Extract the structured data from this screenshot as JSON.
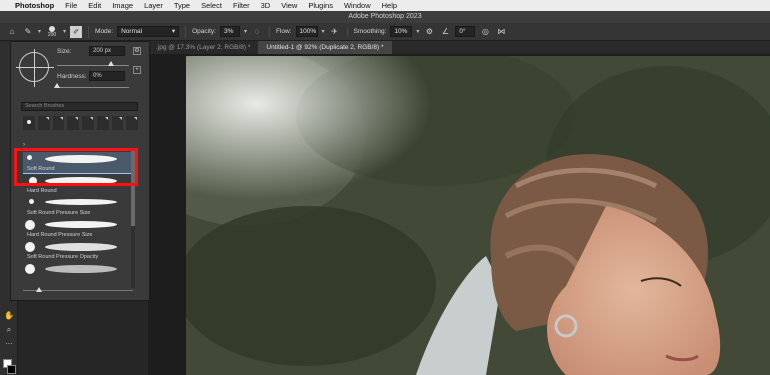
{
  "menubar": {
    "apple_icon": "apple-logo",
    "items": [
      {
        "label": "Photoshop",
        "bold": true
      },
      {
        "label": "File"
      },
      {
        "label": "Edit"
      },
      {
        "label": "Image"
      },
      {
        "label": "Layer"
      },
      {
        "label": "Type"
      },
      {
        "label": "Select"
      },
      {
        "label": "Filter"
      },
      {
        "label": "3D"
      },
      {
        "label": "View"
      },
      {
        "label": "Plugins"
      },
      {
        "label": "Window"
      },
      {
        "label": "Help"
      }
    ]
  },
  "window": {
    "title": "Adobe Photoshop 2023"
  },
  "options": {
    "brush_size_preview": "200",
    "mode_label": "Mode:",
    "mode_value": "Normal",
    "opacity_label": "Opacity:",
    "opacity_value": "3%",
    "flow_label": "Flow:",
    "flow_value": "100%",
    "smoothing_label": "Smoothing:",
    "smoothing_value": "10%",
    "angle_value": "0°"
  },
  "tabs": [
    {
      "label": ".jpg @ 17.3% (Layer 2, RGB/8) *",
      "active": false
    },
    {
      "label": "Untitled-1 @ 92% (Duplicate 2, RGB/8) *",
      "active": true
    }
  ],
  "brush_panel": {
    "size_label": "Size:",
    "size_value": "200 px",
    "size_level": 0.75,
    "hardness_label": "Hardness:",
    "hardness_value": "0%",
    "hardness_level": 0.0,
    "search_placeholder": "Search Brushes",
    "brushes": [
      {
        "label": "Soft Round",
        "selected": true
      },
      {
        "label": "Hard Round",
        "selected": false
      },
      {
        "label": "Soft Round Pressure Size",
        "selected": false
      },
      {
        "label": "Hard Round Pressure Size",
        "selected": false
      },
      {
        "label": "Soft Round Pressure Opacity",
        "selected": false
      }
    ]
  },
  "colors": {
    "highlight": "#ff1111",
    "panel_bg": "#3a3a3a",
    "selection": "#4a5a6b"
  }
}
